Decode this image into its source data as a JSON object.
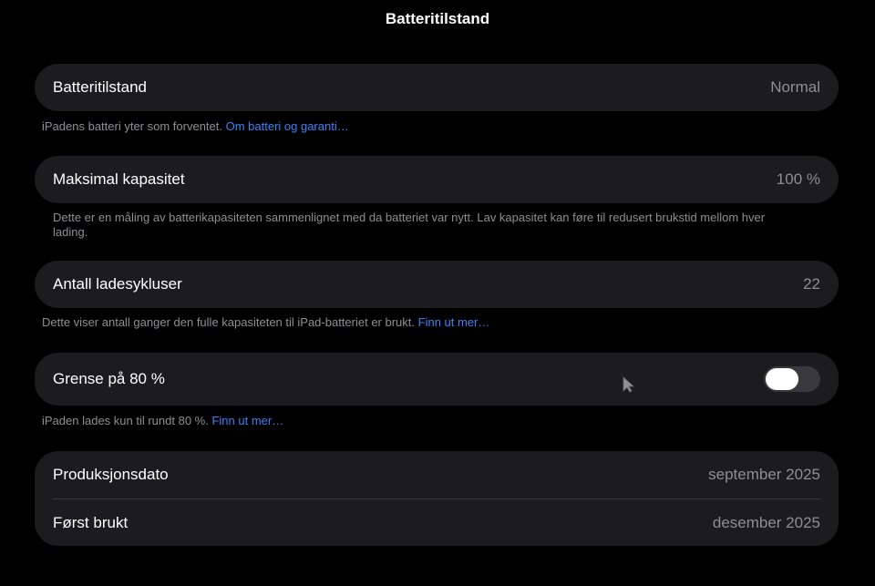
{
  "header": {
    "title": "Batteritilstand"
  },
  "battery_health": {
    "label": "Batteritilstand",
    "value": "Normal",
    "note_text": "iPadens batteri yter som forventet.",
    "note_link": "Om batteri og garanti…"
  },
  "max_capacity": {
    "label": "Maksimal kapasitet",
    "value": "100 %",
    "note_text": "Dette er en måling av batterikapasiteten sammenlignet med da batteriet var nytt. Lav kapasitet kan føre til redusert brukstid mellom hver lading."
  },
  "charge_cycles": {
    "label": "Antall ladesykluser",
    "value": "22",
    "note_text": "Dette viser antall ganger den fulle kapasiteten til iPad-batteriet er brukt.",
    "note_link": "Finn ut mer…"
  },
  "limit_80": {
    "label": "Grense på 80 %",
    "toggle_on": false,
    "note_text": "iPaden lades kun til rundt 80 %.",
    "note_link": "Finn ut mer…"
  },
  "info": {
    "production_label": "Produksjonsdato",
    "production_value": "september 2025",
    "first_used_label": "Først brukt",
    "first_used_value": "desember 2025"
  },
  "colors": {
    "background": "#000000",
    "card": "#1c1c1e",
    "secondary_text": "#8e8e93",
    "link": "#3b82f6"
  }
}
